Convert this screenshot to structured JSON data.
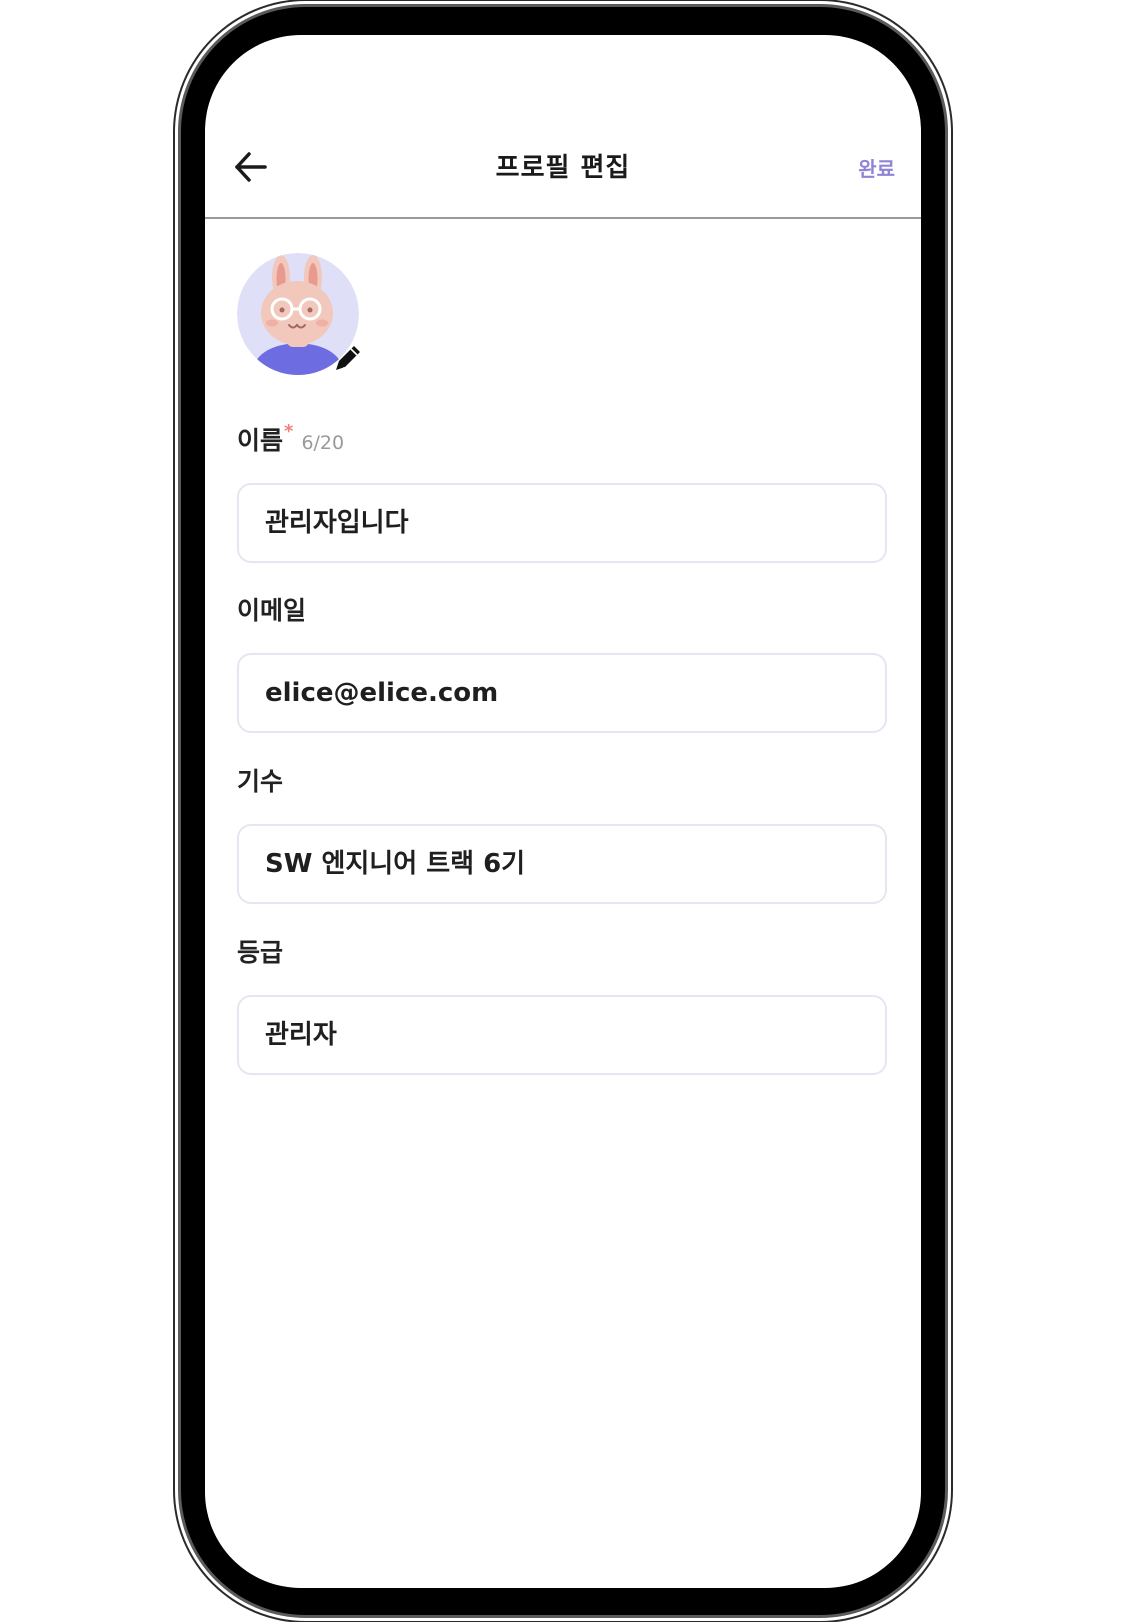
{
  "header": {
    "title": "프로필 편집",
    "done_label": "완료"
  },
  "profile": {
    "avatar_icon": "bunny-avatar-icon",
    "edit_icon": "pencil-icon"
  },
  "fields": {
    "name": {
      "label": "이름",
      "required_mark": "*",
      "counter": "6/20",
      "value": "관리자입니다"
    },
    "email": {
      "label": "이메일",
      "value": "elice@elice.com"
    },
    "cohort": {
      "label": "기수",
      "value": "SW 엔지니어 트랙 6기"
    },
    "grade": {
      "label": "등급",
      "value": "관리자"
    }
  },
  "colors": {
    "accent": "#8f84d6",
    "required": "#f08080",
    "field_border": "#e6e6f2",
    "avatar_bg": "#dfe0f7",
    "avatar_shirt": "#6d6ce0"
  }
}
